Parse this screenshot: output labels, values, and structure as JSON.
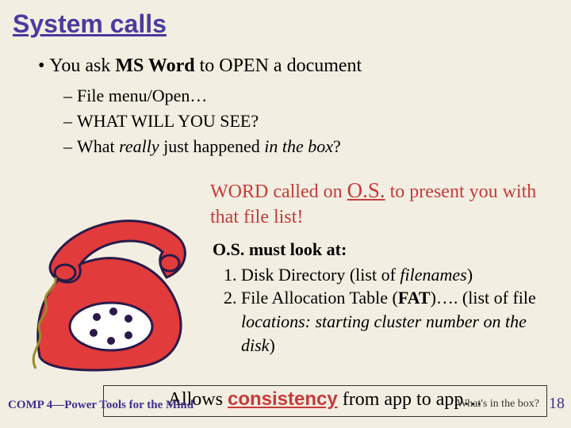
{
  "title": "System calls",
  "bullet": {
    "lead": "You ask ",
    "strong": "MS Word",
    "tail": " to OPEN a document"
  },
  "subs": {
    "s1": "File menu/Open…",
    "s2": "WHAT WILL YOU SEE?",
    "s3_lead": "What ",
    "s3_em1": "really",
    "s3_mid": " just happened ",
    "s3_em2": "in the box",
    "s3_tail": "?"
  },
  "wordcall": {
    "lead": "WORD called on ",
    "os": "O.S.",
    "tail": " to present you with that file list!"
  },
  "lookat": {
    "header": "O.S. must look at:",
    "i1_lead": "Disk Directory (list of ",
    "i1_em": "filenames",
    "i1_tail": ")",
    "i2_lead": "File Allocation Table (",
    "i2_strong": "FAT",
    "i2_mid": ")…. (list of file ",
    "i2_em": "locations: starting cluster number on the disk",
    "i2_tail": ")"
  },
  "consistency": {
    "lead": "Allows ",
    "keyword": "consistency",
    "tail": " from app to app…"
  },
  "footer": {
    "left": "COMP 4—Power Tools for the Mind",
    "right": "What's in the box?",
    "page": "18"
  }
}
